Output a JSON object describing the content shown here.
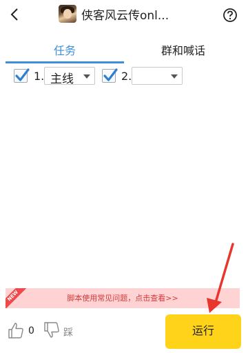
{
  "header": {
    "title": "侠客风云传onl...",
    "back_icon": "chevron-left-icon",
    "help_icon": "question-circle-icon"
  },
  "tabs": [
    {
      "label": "任务",
      "active": true
    },
    {
      "label": "群和喊话",
      "active": false
    }
  ],
  "tasks": [
    {
      "checked": true,
      "number": "1.",
      "selected": "主线"
    },
    {
      "checked": true,
      "number": "2.",
      "selected": ""
    }
  ],
  "notice": {
    "badge": "NEW",
    "text": "脚本使用常见问题，点击查看>>"
  },
  "footer": {
    "like_count": "0",
    "dislike_label": "踩",
    "run_label": "运行"
  },
  "colors": {
    "accent": "#3c8fd8",
    "run_button": "#ffd31a",
    "notice_bg": "#ffd3d3",
    "notice_text": "#d23b3b",
    "arrow": "#e8362d"
  }
}
